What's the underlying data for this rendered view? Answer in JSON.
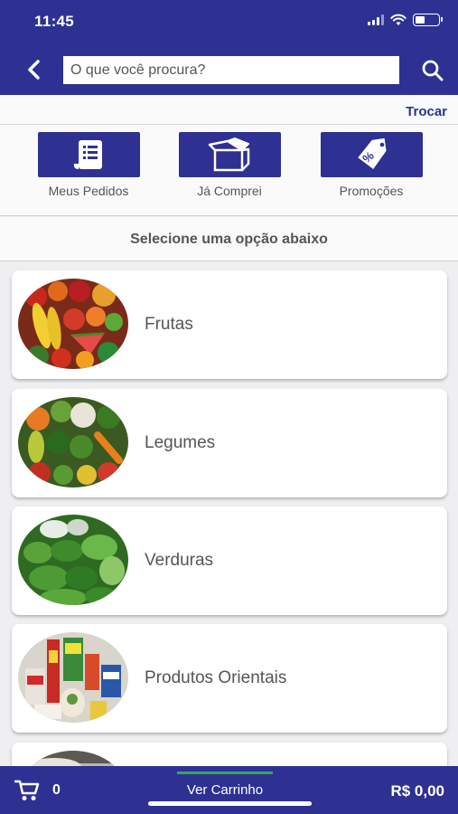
{
  "status_bar": {
    "time": "11:45"
  },
  "search": {
    "placeholder": "O que você procura?",
    "value": ""
  },
  "subbar": {
    "trocar_label": "Trocar"
  },
  "quick_actions": [
    {
      "label": "Meus Pedidos",
      "icon": "receipt-icon"
    },
    {
      "label": "Já Comprei",
      "icon": "open-box-icon"
    },
    {
      "label": "Promoções",
      "icon": "percent-tag-icon"
    }
  ],
  "section": {
    "title": "Selecione uma opção abaixo"
  },
  "categories": [
    {
      "name": "Frutas",
      "image": "fruits-photo"
    },
    {
      "name": "Legumes",
      "image": "vegetables-photo"
    },
    {
      "name": "Verduras",
      "image": "leafy-greens-photo"
    },
    {
      "name": "Produtos Orientais",
      "image": "oriental-products-photo"
    },
    {
      "name": "",
      "image": "category-photo"
    }
  ],
  "cart": {
    "count": "0",
    "view_label": "Ver Carrinho",
    "total": "R$ 0,00"
  },
  "colors": {
    "brand": "#2e3192",
    "accent": "#33aa55",
    "background": "#efeff1"
  }
}
